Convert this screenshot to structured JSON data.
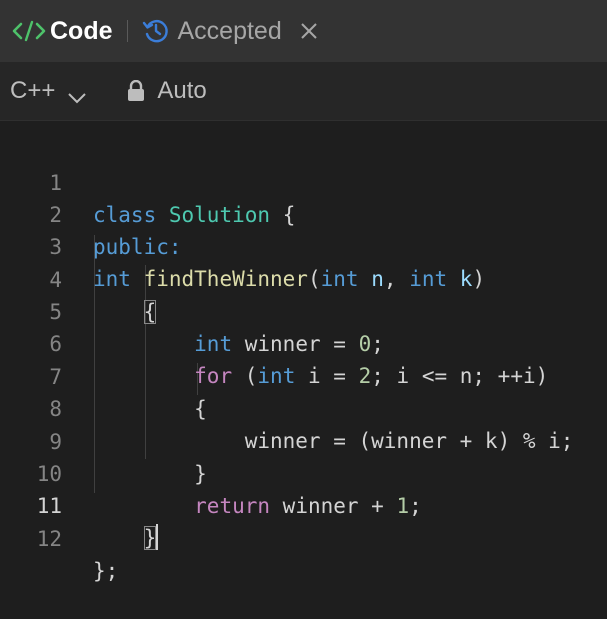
{
  "tabs": {
    "code": {
      "label": "Code",
      "icon": "code-icon"
    },
    "accepted": {
      "label": "Accepted",
      "icon": "history-icon",
      "close_icon": "close-icon"
    }
  },
  "toolbar": {
    "language": "C++",
    "language_icon": "chevron-down-icon",
    "mode": "Auto",
    "mode_icon": "lock-icon"
  },
  "editor": {
    "active_line": 11,
    "lines": [
      {
        "n": "1",
        "text": "class Solution {"
      },
      {
        "n": "2",
        "text": "public:"
      },
      {
        "n": "3",
        "text": "int findTheWinner(int n, int k)"
      },
      {
        "n": "4",
        "text": "{"
      },
      {
        "n": "5",
        "text": "int winner = 0;"
      },
      {
        "n": "6",
        "text": "for (int i = 2; i <= n; ++i)"
      },
      {
        "n": "7",
        "text": "{"
      },
      {
        "n": "8",
        "text": "winner = (winner + k) % i;"
      },
      {
        "n": "9",
        "text": "}"
      },
      {
        "n": "10",
        "text": "return winner + 1;"
      },
      {
        "n": "11",
        "text": "}"
      },
      {
        "n": "12",
        "text": "};"
      }
    ]
  },
  "colors": {
    "keyword": "#569cd6",
    "type": "#4ec9b0",
    "function": "#dcdcaa",
    "control": "#c586c0",
    "number": "#b5cea8",
    "code_icon_green": "#4ec26a"
  }
}
